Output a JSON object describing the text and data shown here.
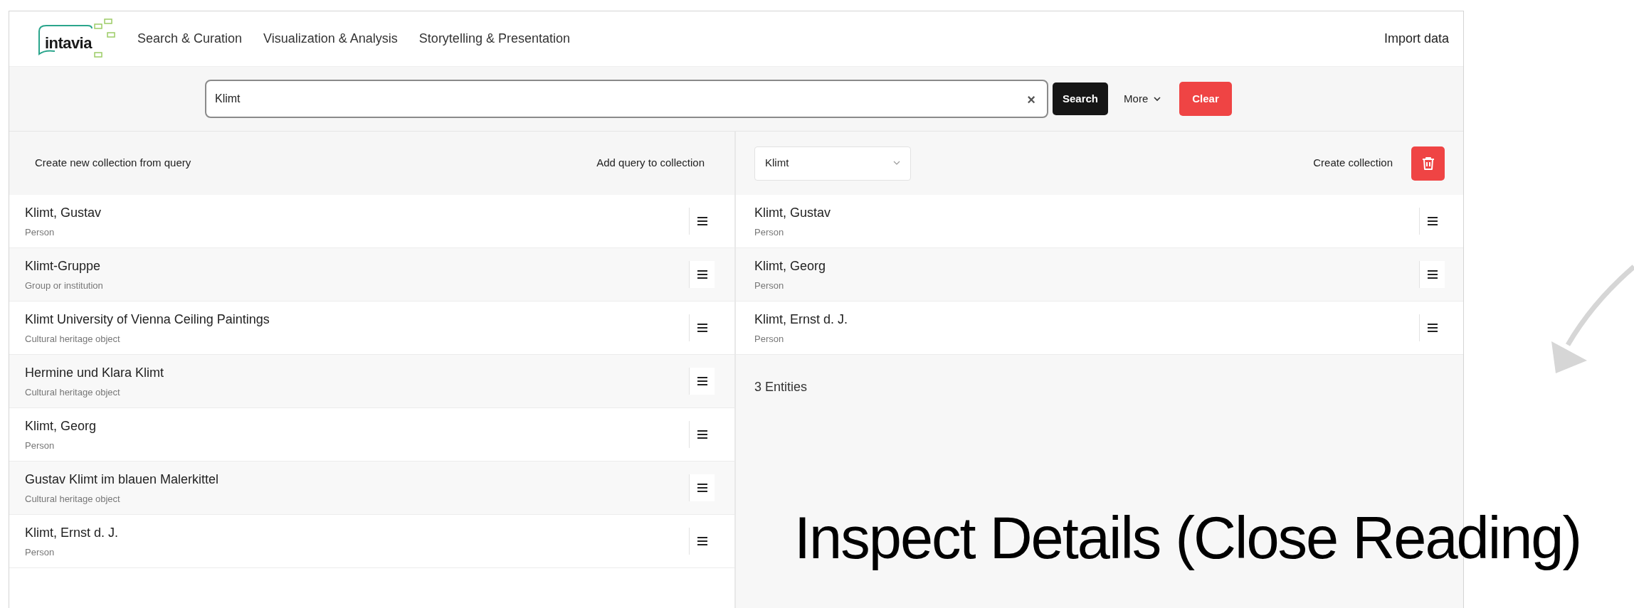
{
  "header": {
    "logo": "intavia",
    "nav": [
      "Search & Curation",
      "Visualization & Analysis",
      "Storytelling & Presentation"
    ],
    "import": "Import data"
  },
  "search": {
    "value": "Klimt",
    "clear_glyph": "×",
    "search_button": "Search",
    "more_button": "More",
    "clear_button": "Clear"
  },
  "results": {
    "actions": [
      "Create new collection from query",
      "Add query to collection"
    ],
    "items": [
      {
        "name": "Klimt, Gustav",
        "type": "Person"
      },
      {
        "name": "Klimt-Gruppe",
        "type": "Group or institution"
      },
      {
        "name": "Klimt University of Vienna Ceiling Paintings",
        "type": "Cultural heritage object"
      },
      {
        "name": "Hermine und Klara Klimt",
        "type": "Cultural heritage object"
      },
      {
        "name": "Klimt, Georg",
        "type": "Person"
      },
      {
        "name": "Gustav Klimt im blauen Malerkittel",
        "type": "Cultural heritage object"
      },
      {
        "name": "Klimt, Ernst d. J.",
        "type": "Person"
      }
    ]
  },
  "collection": {
    "select": "Klimt",
    "create": "Create collection",
    "items": [
      {
        "name": "Klimt, Gustav",
        "type": "Person"
      },
      {
        "name": "Klimt, Georg",
        "type": "Person"
      },
      {
        "name": "Klimt, Ernst d. J.",
        "type": "Person"
      }
    ],
    "count": "3 Entities"
  },
  "caption": "Inspect Details (Close Reading)"
}
